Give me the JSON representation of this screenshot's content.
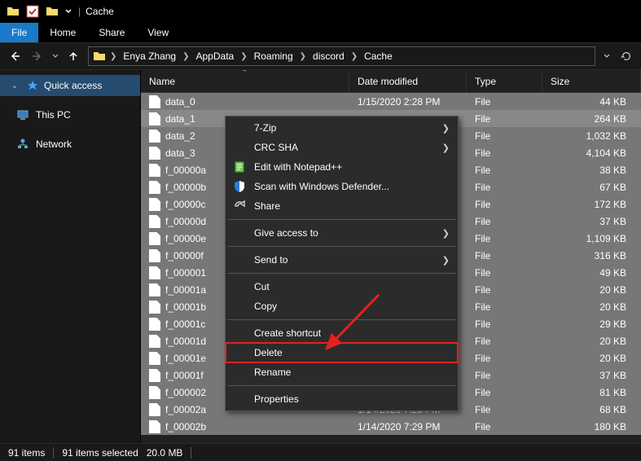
{
  "window": {
    "title": "Cache"
  },
  "ribbon": {
    "file": "File",
    "home": "Home",
    "share": "Share",
    "view": "View"
  },
  "breadcrumb": [
    "Enya Zhang",
    "AppData",
    "Roaming",
    "discord",
    "Cache"
  ],
  "sidebar": {
    "quick": "Quick access",
    "thispc": "This PC",
    "network": "Network"
  },
  "columns": {
    "name": "Name",
    "date": "Date modified",
    "type": "Type",
    "size": "Size"
  },
  "files": [
    {
      "name": "data_0",
      "date": "1/15/2020 2:28 PM",
      "type": "File",
      "size": "44 KB",
      "sel": true,
      "showdate": true
    },
    {
      "name": "data_1",
      "date": "",
      "type": "File",
      "size": "264 KB",
      "sel": true,
      "focused": true
    },
    {
      "name": "data_2",
      "date": "",
      "type": "File",
      "size": "1,032 KB",
      "sel": true
    },
    {
      "name": "data_3",
      "date": "",
      "type": "File",
      "size": "4,104 KB",
      "sel": true
    },
    {
      "name": "f_00000a",
      "date": "",
      "type": "File",
      "size": "38 KB",
      "sel": true
    },
    {
      "name": "f_00000b",
      "date": "",
      "type": "File",
      "size": "67 KB",
      "sel": true
    },
    {
      "name": "f_00000c",
      "date": "",
      "type": "File",
      "size": "172 KB",
      "sel": true
    },
    {
      "name": "f_00000d",
      "date": "",
      "type": "File",
      "size": "37 KB",
      "sel": true
    },
    {
      "name": "f_00000e",
      "date": "",
      "type": "File",
      "size": "1,109 KB",
      "sel": true
    },
    {
      "name": "f_00000f",
      "date": "",
      "type": "File",
      "size": "316 KB",
      "sel": true
    },
    {
      "name": "f_000001",
      "date": "",
      "type": "File",
      "size": "49 KB",
      "sel": true
    },
    {
      "name": "f_00001a",
      "date": "",
      "type": "File",
      "size": "20 KB",
      "sel": true
    },
    {
      "name": "f_00001b",
      "date": "",
      "type": "File",
      "size": "20 KB",
      "sel": true
    },
    {
      "name": "f_00001c",
      "date": "",
      "type": "File",
      "size": "29 KB",
      "sel": true
    },
    {
      "name": "f_00001d",
      "date": "",
      "type": "File",
      "size": "20 KB",
      "sel": true
    },
    {
      "name": "f_00001e",
      "date": "",
      "type": "File",
      "size": "20 KB",
      "sel": true
    },
    {
      "name": "f_00001f",
      "date": "",
      "type": "File",
      "size": "37 KB",
      "sel": true
    },
    {
      "name": "f_000002",
      "date": "",
      "type": "File",
      "size": "81 KB",
      "sel": true
    },
    {
      "name": "f_00002a",
      "date": "1/14/2020 7:29 PM",
      "type": "File",
      "size": "68 KB",
      "sel": true,
      "showdate": true
    },
    {
      "name": "f_00002b",
      "date": "1/14/2020 7:29 PM",
      "type": "File",
      "size": "180 KB",
      "sel": true,
      "showdate": true
    }
  ],
  "context_menu": [
    {
      "label": "7-Zip",
      "submenu": true
    },
    {
      "label": "CRC SHA",
      "submenu": true
    },
    {
      "label": "Edit with Notepad++",
      "icon": "notepad"
    },
    {
      "label": "Scan with Windows Defender...",
      "icon": "defender"
    },
    {
      "label": "Share",
      "icon": "share"
    },
    {
      "sep": true
    },
    {
      "label": "Give access to",
      "submenu": true
    },
    {
      "sep": true
    },
    {
      "label": "Send to",
      "submenu": true
    },
    {
      "sep": true
    },
    {
      "label": "Cut"
    },
    {
      "label": "Copy"
    },
    {
      "sep": true
    },
    {
      "label": "Create shortcut"
    },
    {
      "label": "Delete",
      "highlight": true
    },
    {
      "label": "Rename"
    },
    {
      "sep": true
    },
    {
      "label": "Properties"
    }
  ],
  "status": {
    "items": "91 items",
    "selected": "91 items selected",
    "size": "20.0 MB"
  }
}
